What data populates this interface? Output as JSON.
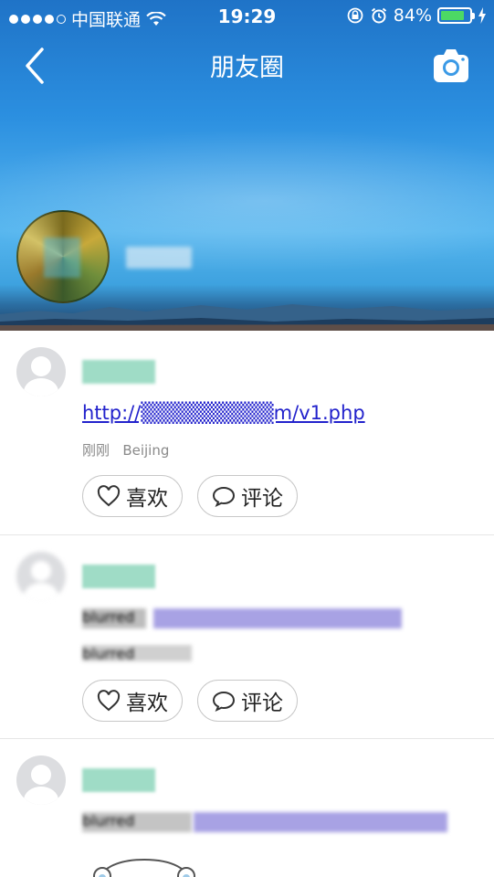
{
  "status_bar": {
    "carrier": "中国联通",
    "time": "19:29",
    "battery_percent": "84%",
    "battery_level": 0.84,
    "signal_bars": 4
  },
  "nav": {
    "title": "朋友圈"
  },
  "cover": {
    "username": "blurred"
  },
  "posts": [
    {
      "name": "blurred",
      "link": "http://▒▒▒▒▒▒▒▒▒m/v1.php",
      "time": "刚刚",
      "location": "Beijing",
      "like_label": "喜欢",
      "comment_label": "评论"
    },
    {
      "name": "blurred",
      "text": "blurred",
      "meta": "blurred",
      "like_label": "喜欢",
      "comment_label": "评论"
    },
    {
      "name": "blurred",
      "text": "blurred"
    }
  ],
  "colors": {
    "link": "#2222cc",
    "battery": "#4cd964",
    "name_placeholder": "#9fdcc6"
  }
}
